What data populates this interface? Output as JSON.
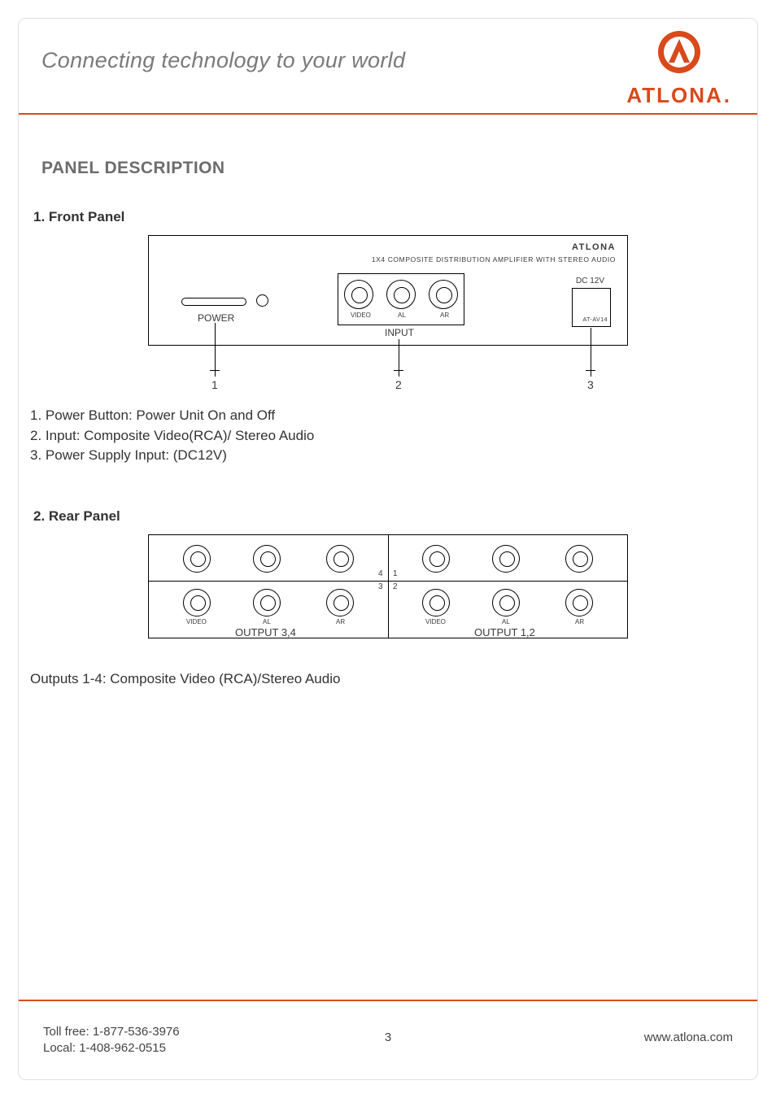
{
  "header": {
    "tagline": "Connecting technology to your world",
    "brand": "ATLONA"
  },
  "section_title": "PANEL DESCRIPTION",
  "front": {
    "heading": "1. Front Panel",
    "brand": "ATLONA",
    "subtitle": "1x4 COMPOSITE DISTRIBUTION AMPLIFIER WITH STEREO AUDIO",
    "dc_label": "DC 12V",
    "model": "AT-AV14",
    "power_label": "POWER",
    "input_label": "INPUT",
    "rca_labels": {
      "video": "VIDEO",
      "al": "AL",
      "ar": "AR"
    },
    "callouts": {
      "n1": "1",
      "n2": "2",
      "n3": "3"
    },
    "notes": [
      "1. Power Button: Power Unit On and Off",
      "2. Input: Composite Video(RCA)/ Stereo Audio",
      "3. Power Supply Input: (DC12V)"
    ]
  },
  "rear": {
    "heading": "2. Rear Panel",
    "left_group": "OUTPUT 3,4",
    "right_group": "OUTPUT 1,2",
    "col_labels": {
      "video": "VIDEO",
      "al": "AL",
      "ar": "AR"
    },
    "nums": {
      "n1": "1",
      "n2": "2",
      "n3": "3",
      "n4": "4"
    },
    "note": "Outputs 1-4: Composite Video (RCA)/Stereo Audio"
  },
  "footer": {
    "tollfree": "Toll free: 1-877-536-3976",
    "local": "Local: 1-408-962-0515",
    "page": "3",
    "site": "www.atlona.com"
  }
}
